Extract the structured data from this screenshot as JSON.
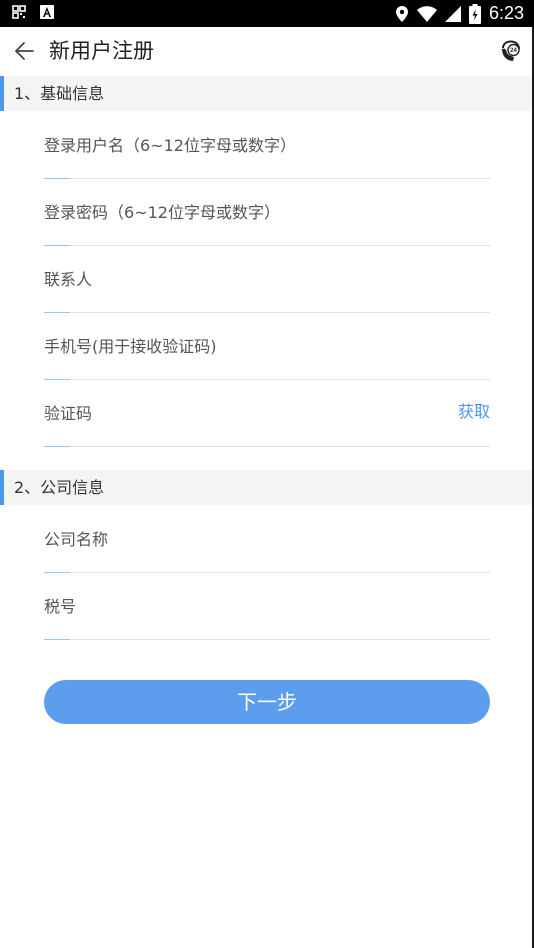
{
  "status_bar": {
    "time": "6:23",
    "icons": [
      "qr-code-icon",
      "accessibility-icon",
      "location-icon",
      "wifi-icon",
      "signal-icon",
      "battery-icon"
    ]
  },
  "toolbar": {
    "title": "新用户注册",
    "back_icon": "back-arrow-icon",
    "support_icon": "phone-24h-icon"
  },
  "sections": [
    {
      "title": "1、基础信息",
      "fields": [
        {
          "placeholder": "登录用户名（6~12位字母或数字）",
          "value": ""
        },
        {
          "placeholder": "登录密码（6~12位字母或数字）",
          "value": ""
        },
        {
          "placeholder": "联系人",
          "value": ""
        },
        {
          "placeholder": "手机号(用于接收验证码)",
          "value": ""
        },
        {
          "placeholder": "验证码",
          "value": "",
          "action_label": "获取"
        }
      ]
    },
    {
      "title": "2、公司信息",
      "fields": [
        {
          "placeholder": "公司名称",
          "value": ""
        },
        {
          "placeholder": "税号",
          "value": ""
        }
      ]
    }
  ],
  "next_button": {
    "label": "下一步"
  },
  "colors": {
    "accent": "#4f97e8",
    "button": "#5d9ded",
    "section_bg": "#f4f4f4"
  }
}
